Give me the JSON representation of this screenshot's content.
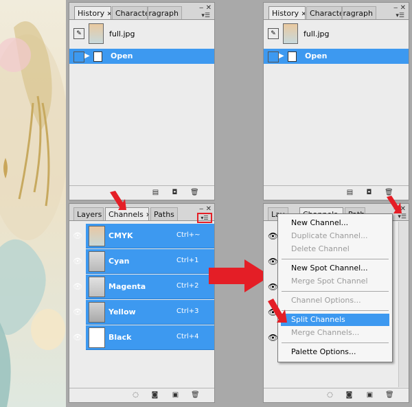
{
  "colors": {
    "selection": "#3d99f0",
    "arrow": "#e41e26",
    "panel": "#ececec"
  },
  "history_panel": {
    "tabs": [
      "History",
      "Character",
      "Paragraph"
    ],
    "snapshot_name": "full.jpg",
    "state_name": "Open"
  },
  "channels_panel": {
    "tabs": [
      "Layers",
      "Channels",
      "Paths"
    ],
    "channels": [
      {
        "name": "CMYK",
        "shortcut": "Ctrl+~"
      },
      {
        "name": "Cyan",
        "shortcut": "Ctrl+1"
      },
      {
        "name": "Magenta",
        "shortcut": "Ctrl+2"
      },
      {
        "name": "Yellow",
        "shortcut": "Ctrl+3"
      },
      {
        "name": "Black",
        "shortcut": "Ctrl+4"
      }
    ]
  },
  "right_channels_tabs": [
    "Lay",
    "Channels",
    "Path"
  ],
  "menu": {
    "items": [
      {
        "label": "New Channel...",
        "enabled": true
      },
      {
        "label": "Duplicate Channel...",
        "enabled": false
      },
      {
        "label": "Delete Channel",
        "enabled": false
      },
      {
        "label": "New Spot Channel...",
        "enabled": true
      },
      {
        "label": "Merge Spot Channel",
        "enabled": false
      },
      {
        "label": "Channel Options...",
        "enabled": false
      },
      {
        "label": "Split Channels",
        "enabled": true,
        "highlighted": true
      },
      {
        "label": "Merge Channels...",
        "enabled": false
      },
      {
        "label": "Palette Options...",
        "enabled": true
      }
    ]
  },
  "icons": [
    "close-icon",
    "panel-menu-icon",
    "eye-icon",
    "brush-icon",
    "new-document-icon",
    "camera-icon",
    "trash-icon",
    "load-selection-icon",
    "save-selection-icon",
    "new-channel-icon",
    "arrow-icon"
  ]
}
